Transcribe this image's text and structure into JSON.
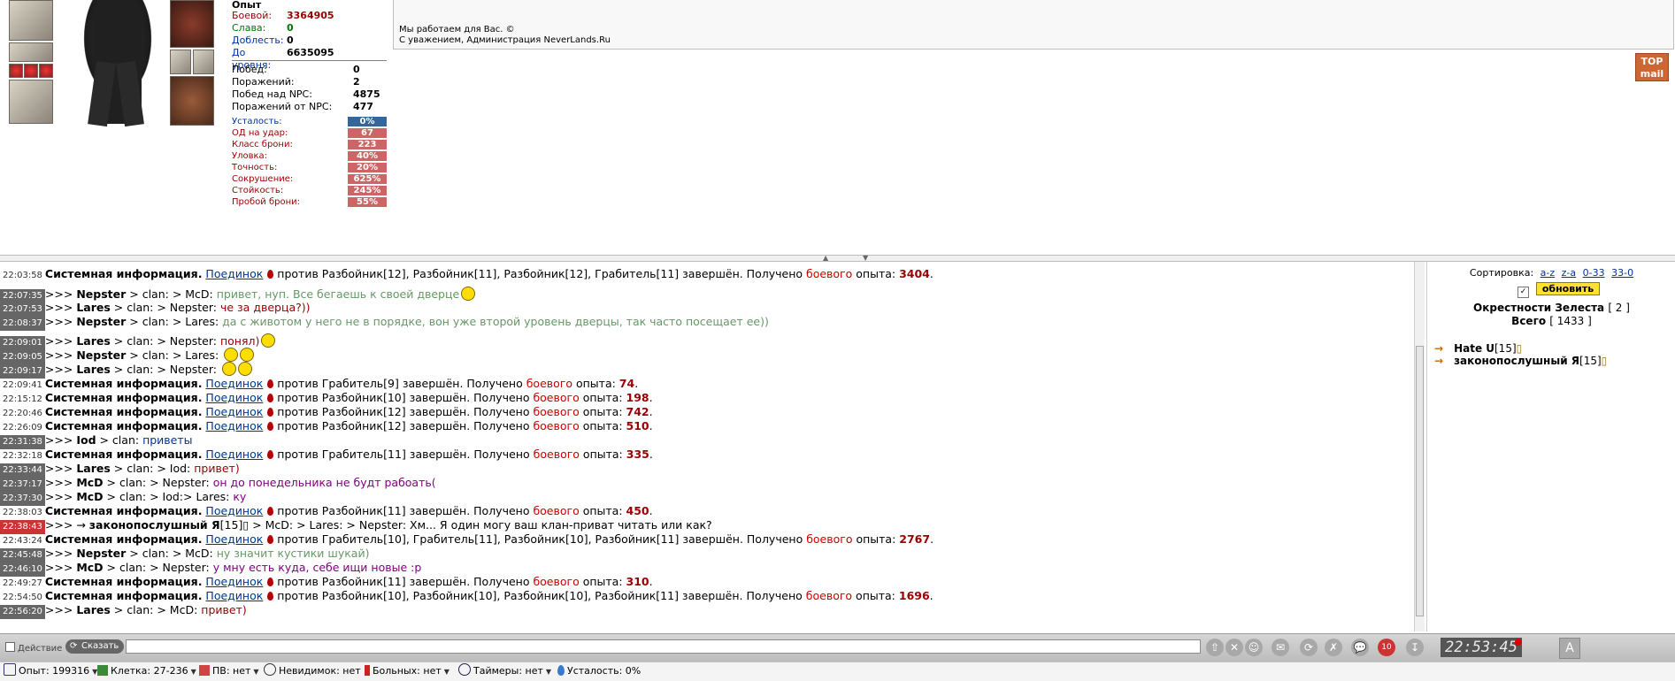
{
  "character": {
    "stats_title": "Опыт",
    "experience": [
      {
        "label": "Боевой:",
        "value": "3364905",
        "kind": "combat"
      },
      {
        "label": "Слава:",
        "value": "0",
        "kind": "glory"
      },
      {
        "label": "Доблесть:",
        "value": "0",
        "kind": "valor"
      },
      {
        "label": "До уровня:",
        "value": "6635095",
        "kind": "next"
      }
    ],
    "wins": [
      {
        "label": "Побед:",
        "value": "0"
      },
      {
        "label": "Поражений:",
        "value": "2"
      },
      {
        "label": "Побед над NPC:",
        "value": "4875"
      },
      {
        "label": "Поражений от NPC:",
        "value": "477"
      }
    ],
    "bars": [
      {
        "label": "Усталость:",
        "value": "0%",
        "color": "#336699"
      },
      {
        "label": "ОД на удар:",
        "value": "67",
        "color": "#cc6666"
      },
      {
        "label": "Класс брони:",
        "value": "223",
        "color": "#cc6666"
      },
      {
        "label": "Уловка:",
        "value": "40%",
        "color": "#cc6666"
      },
      {
        "label": "Точность:",
        "value": "20%",
        "color": "#cc6666"
      },
      {
        "label": "Сокрушение:",
        "value": "625%",
        "color": "#cc6666"
      },
      {
        "label": "Стойкость:",
        "value": "245%",
        "color": "#cc6666"
      },
      {
        "label": "Пробой брони:",
        "value": "55%",
        "color": "#cc6666"
      }
    ]
  },
  "news": {
    "line1": "Мы работаем для Вас. ©",
    "line2": "С уважением, Администрация NeverLands.Ru"
  },
  "topmail": {
    "l1": "TOP",
    "l2": "mail"
  },
  "chat": {
    "messages": [
      {
        "ts": "22:03:58",
        "parts": [
          {
            "t": "Системная информация.",
            "c": "sys"
          },
          {
            "t": " ",
            "c": ""
          },
          {
            "t": "Поединок",
            "c": "lnk"
          },
          {
            "t": "",
            "c": "drop"
          },
          {
            "t": "против Разбойник[12], Разбойник[11], Разбойник[12], Грабитель[11] завершён. Получено ",
            "c": ""
          },
          {
            "t": "боевого",
            "c": "red"
          },
          {
            "t": " опыта: ",
            "c": ""
          },
          {
            "t": "3404",
            "c": "bnum"
          },
          {
            "t": ".",
            "c": ""
          }
        ]
      },
      {
        "ts": "22:07:35",
        "tsStyle": "hl",
        "parts": [
          {
            "t": ">>> ",
            "c": ""
          },
          {
            "t": "Nepster",
            "c": "nick"
          },
          {
            "t": " > clan: > McD: ",
            "c": ""
          },
          {
            "t": "привет, нуп. Все бегаешь к своей дверце",
            "c": "green"
          },
          {
            "t": "",
            "c": "smile"
          }
        ]
      },
      {
        "ts": "22:07:53",
        "tsStyle": "hl",
        "parts": [
          {
            "t": ">>> ",
            "c": ""
          },
          {
            "t": "Lares",
            "c": "nick"
          },
          {
            "t": " > clan: > Nepster: ",
            "c": ""
          },
          {
            "t": "че за дверца?))",
            "c": "maroon"
          }
        ]
      },
      {
        "ts": "22:08:37",
        "tsStyle": "hl",
        "parts": [
          {
            "t": ">>> ",
            "c": ""
          },
          {
            "t": "Nepster",
            "c": "nick"
          },
          {
            "t": " > clan: > Lares: ",
            "c": ""
          },
          {
            "t": "да с животом у него не в порядке, вон уже второй уровень дверцы, так часто посещает ее))",
            "c": "green"
          }
        ]
      },
      {
        "ts": "22:09:01",
        "tsStyle": "hl",
        "parts": [
          {
            "t": ">>> ",
            "c": ""
          },
          {
            "t": "Lares",
            "c": "nick"
          },
          {
            "t": " > clan: > Nepster: ",
            "c": ""
          },
          {
            "t": "понял)",
            "c": "maroon"
          },
          {
            "t": "",
            "c": "smile"
          }
        ]
      },
      {
        "ts": "22:09:05",
        "tsStyle": "hl",
        "parts": [
          {
            "t": ">>> ",
            "c": ""
          },
          {
            "t": "Nepster",
            "c": "nick"
          },
          {
            "t": " > clan: > Lares: ",
            "c": ""
          },
          {
            "t": "",
            "c": "smile"
          },
          {
            "t": "",
            "c": "smile"
          }
        ]
      },
      {
        "ts": "22:09:17",
        "tsStyle": "hl",
        "parts": [
          {
            "t": ">>> ",
            "c": ""
          },
          {
            "t": "Lares",
            "c": "nick"
          },
          {
            "t": " > clan: > Nepster: ",
            "c": ""
          },
          {
            "t": "",
            "c": "smile"
          },
          {
            "t": "",
            "c": "smile"
          }
        ]
      },
      {
        "ts": "22:09:41",
        "parts": [
          {
            "t": "Системная информация.",
            "c": "sys"
          },
          {
            "t": " ",
            "c": ""
          },
          {
            "t": "Поединок",
            "c": "lnk"
          },
          {
            "t": "",
            "c": "drop"
          },
          {
            "t": "против Грабитель[9] завершён. Получено ",
            "c": ""
          },
          {
            "t": "боевого",
            "c": "red"
          },
          {
            "t": " опыта: ",
            "c": ""
          },
          {
            "t": "74",
            "c": "bnum"
          },
          {
            "t": ".",
            "c": ""
          }
        ]
      },
      {
        "ts": "22:15:12",
        "parts": [
          {
            "t": "Системная информация.",
            "c": "sys"
          },
          {
            "t": " ",
            "c": ""
          },
          {
            "t": "Поединок",
            "c": "lnk"
          },
          {
            "t": "",
            "c": "drop"
          },
          {
            "t": "против Разбойник[10] завершён. Получено ",
            "c": ""
          },
          {
            "t": "боевого",
            "c": "red"
          },
          {
            "t": " опыта: ",
            "c": ""
          },
          {
            "t": "198",
            "c": "bnum"
          },
          {
            "t": ".",
            "c": ""
          }
        ]
      },
      {
        "ts": "22:20:46",
        "parts": [
          {
            "t": "Системная информация.",
            "c": "sys"
          },
          {
            "t": " ",
            "c": ""
          },
          {
            "t": "Поединок",
            "c": "lnk"
          },
          {
            "t": "",
            "c": "drop"
          },
          {
            "t": "против Разбойник[12] завершён. Получено ",
            "c": ""
          },
          {
            "t": "боевого",
            "c": "red"
          },
          {
            "t": " опыта: ",
            "c": ""
          },
          {
            "t": "742",
            "c": "bnum"
          },
          {
            "t": ".",
            "c": ""
          }
        ]
      },
      {
        "ts": "22:26:09",
        "parts": [
          {
            "t": "Системная информация.",
            "c": "sys"
          },
          {
            "t": " ",
            "c": ""
          },
          {
            "t": "Поединок",
            "c": "lnk"
          },
          {
            "t": "",
            "c": "drop"
          },
          {
            "t": "против Разбойник[12] завершён. Получено ",
            "c": ""
          },
          {
            "t": "боевого",
            "c": "red"
          },
          {
            "t": " опыта: ",
            "c": ""
          },
          {
            "t": "510",
            "c": "bnum"
          },
          {
            "t": ".",
            "c": ""
          }
        ]
      },
      {
        "ts": "22:31:38",
        "tsStyle": "hl",
        "parts": [
          {
            "t": ">>> ",
            "c": ""
          },
          {
            "t": "Iod",
            "c": "nick"
          },
          {
            "t": " > clan: ",
            "c": ""
          },
          {
            "t": "приветы",
            "c": "blue"
          }
        ]
      },
      {
        "ts": "22:32:18",
        "parts": [
          {
            "t": "Системная информация.",
            "c": "sys"
          },
          {
            "t": " ",
            "c": ""
          },
          {
            "t": "Поединок",
            "c": "lnk"
          },
          {
            "t": "",
            "c": "drop"
          },
          {
            "t": "против Грабитель[11] завершён. Получено ",
            "c": ""
          },
          {
            "t": "боевого",
            "c": "red"
          },
          {
            "t": " опыта: ",
            "c": ""
          },
          {
            "t": "335",
            "c": "bnum"
          },
          {
            "t": ".",
            "c": ""
          }
        ]
      },
      {
        "ts": "22:33:44",
        "tsStyle": "hl",
        "parts": [
          {
            "t": ">>> ",
            "c": ""
          },
          {
            "t": "Lares",
            "c": "nick"
          },
          {
            "t": " > clan: > Iod: ",
            "c": ""
          },
          {
            "t": "привет)",
            "c": "maroon"
          }
        ]
      },
      {
        "ts": "22:37:17",
        "tsStyle": "hl",
        "parts": [
          {
            "t": ">>> ",
            "c": ""
          },
          {
            "t": "McD",
            "c": "nick"
          },
          {
            "t": " > clan: > Nepster: ",
            "c": ""
          },
          {
            "t": "он до понедельника не будт рабоать(",
            "c": "purple"
          }
        ]
      },
      {
        "ts": "22:37:30",
        "tsStyle": "hl",
        "parts": [
          {
            "t": ">>> ",
            "c": ""
          },
          {
            "t": "McD",
            "c": "nick"
          },
          {
            "t": " > clan: > Iod:> Lares: ",
            "c": ""
          },
          {
            "t": "ку",
            "c": "purple"
          }
        ]
      },
      {
        "ts": "22:38:03",
        "parts": [
          {
            "t": "Системная информация.",
            "c": "sys"
          },
          {
            "t": " ",
            "c": ""
          },
          {
            "t": "Поединок",
            "c": "lnk"
          },
          {
            "t": "",
            "c": "drop"
          },
          {
            "t": "против Разбойник[11] завершён. Получено ",
            "c": ""
          },
          {
            "t": "боевого",
            "c": "red"
          },
          {
            "t": " опыта: ",
            "c": ""
          },
          {
            "t": "450",
            "c": "bnum"
          },
          {
            "t": ".",
            "c": ""
          }
        ]
      },
      {
        "ts": "22:38:43",
        "tsStyle": "red",
        "parts": [
          {
            "t": ">>> → ",
            "c": ""
          },
          {
            "t": "законопослушный Я",
            "c": "nick"
          },
          {
            "t": "[15]▯ > McD: > Lares: > Nepster: Хм... Я один могу ваш клан-приват читать или как?",
            "c": ""
          }
        ]
      },
      {
        "ts": "22:43:24",
        "parts": [
          {
            "t": "Системная информация.",
            "c": "sys"
          },
          {
            "t": " ",
            "c": ""
          },
          {
            "t": "Поединок",
            "c": "lnk"
          },
          {
            "t": "",
            "c": "drop"
          },
          {
            "t": "против Грабитель[10], Грабитель[11], Разбойник[10], Разбойник[11] завершён. Получено ",
            "c": ""
          },
          {
            "t": "боевого",
            "c": "red"
          },
          {
            "t": " опыта: ",
            "c": ""
          },
          {
            "t": "2767",
            "c": "bnum"
          },
          {
            "t": ".",
            "c": ""
          }
        ]
      },
      {
        "ts": "22:45:48",
        "tsStyle": "hl",
        "parts": [
          {
            "t": ">>> ",
            "c": ""
          },
          {
            "t": "Nepster",
            "c": "nick"
          },
          {
            "t": " > clan: > McD: ",
            "c": ""
          },
          {
            "t": "ну значит кустики шукай)",
            "c": "green"
          }
        ]
      },
      {
        "ts": "22:46:10",
        "tsStyle": "hl",
        "parts": [
          {
            "t": ">>> ",
            "c": ""
          },
          {
            "t": "McD",
            "c": "nick"
          },
          {
            "t": " > clan: > Nepster: ",
            "c": ""
          },
          {
            "t": "у мну есть куда, себе ищи новые :p",
            "c": "purple"
          }
        ]
      },
      {
        "ts": "22:49:27",
        "parts": [
          {
            "t": "Системная информация.",
            "c": "sys"
          },
          {
            "t": " ",
            "c": ""
          },
          {
            "t": "Поединок",
            "c": "lnk"
          },
          {
            "t": "",
            "c": "drop"
          },
          {
            "t": "против Разбойник[11] завершён. Получено ",
            "c": ""
          },
          {
            "t": "боевого",
            "c": "red"
          },
          {
            "t": " опыта: ",
            "c": ""
          },
          {
            "t": "310",
            "c": "bnum"
          },
          {
            "t": ".",
            "c": ""
          }
        ]
      },
      {
        "ts": "22:54:50",
        "parts": [
          {
            "t": "Системная информация.",
            "c": "sys"
          },
          {
            "t": " ",
            "c": ""
          },
          {
            "t": "Поединок",
            "c": "lnk"
          },
          {
            "t": "",
            "c": "drop"
          },
          {
            "t": "против Разбойник[10], Разбойник[10], Разбойник[10], Разбойник[11] завершён. Получено ",
            "c": ""
          },
          {
            "t": "боевого",
            "c": "red"
          },
          {
            "t": " опыта: ",
            "c": ""
          },
          {
            "t": "1696",
            "c": "bnum"
          },
          {
            "t": ".",
            "c": ""
          }
        ]
      },
      {
        "ts": "22:56:20",
        "tsStyle": "hl",
        "parts": [
          {
            "t": ">>> ",
            "c": ""
          },
          {
            "t": "Lares",
            "c": "nick"
          },
          {
            "t": " > clan: > McD: ",
            "c": ""
          },
          {
            "t": "привет)",
            "c": "maroon"
          }
        ]
      }
    ]
  },
  "users": {
    "sort_label": "Сортировка:",
    "sort_links": [
      "a-z",
      "z-a",
      "0-33",
      "33-0"
    ],
    "refresh_label": "обновить",
    "location": "Окрестности Зелеста",
    "location_count": "[ 2 ]",
    "total_label": "Всего",
    "total_count": "[ 1433 ]",
    "list": [
      {
        "name": "Hate U",
        "level": "[15]"
      },
      {
        "name": "законопослушный Я",
        "level": "[15]"
      }
    ]
  },
  "input": {
    "action_label": "Действие",
    "say_label": "Сказать",
    "clock": "22:53:45",
    "badge": "10"
  },
  "status": {
    "exp": "Опыт: 199316",
    "cell": "Клетка: 27-236",
    "pv": "ПВ: нет",
    "invis": "Невидимок: нет",
    "sick": "Больных: нет",
    "timers": "Таймеры: нет",
    "fatigue": "Усталость: 0%"
  }
}
